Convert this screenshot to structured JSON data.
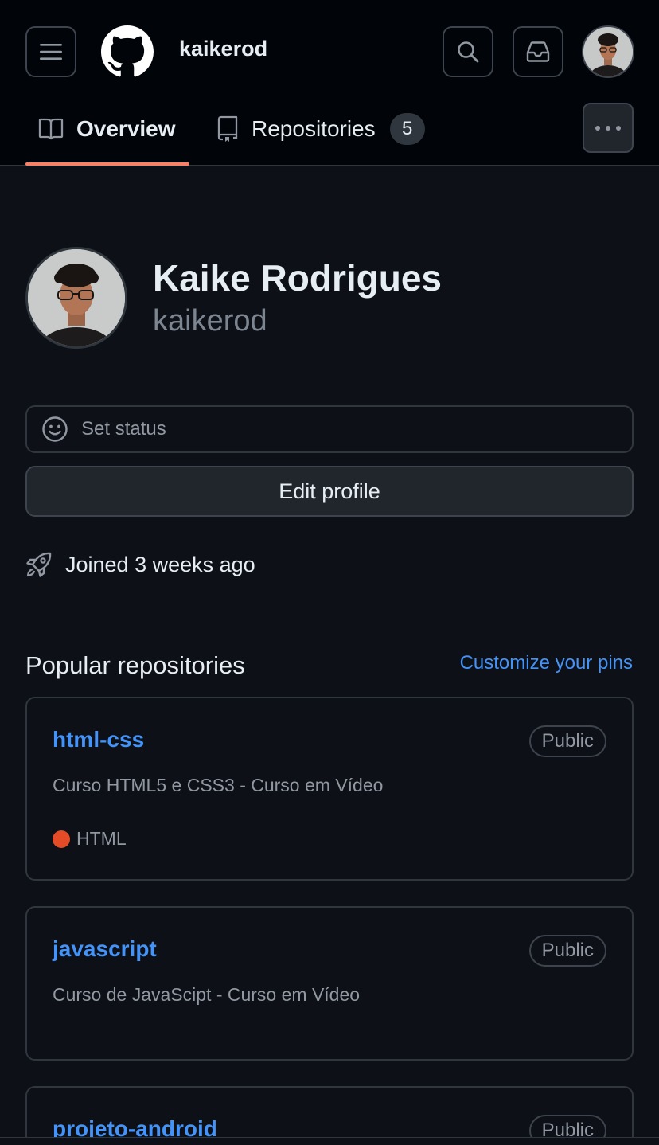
{
  "header": {
    "username": "kaikerod",
    "icons": {
      "menu": "hamburger-icon",
      "logo": "github-mark-icon",
      "search": "search-icon",
      "inbox": "inbox-icon",
      "more": "kebab-horizontal-icon"
    }
  },
  "tabs": [
    {
      "label": "Overview",
      "icon": "book-icon",
      "selected": true
    },
    {
      "label": "Repositories",
      "icon": "repo-icon",
      "count": "5",
      "selected": false
    }
  ],
  "profile": {
    "name": "Kaike Rodrigues",
    "login": "kaikerod",
    "set_status": "Set status",
    "edit_profile": "Edit profile",
    "joined": "Joined 3 weeks ago"
  },
  "popular": {
    "title": "Popular repositories",
    "customize": "Customize your pins",
    "repos": [
      {
        "name": "html-css",
        "visibility": "Public",
        "description": "Curso HTML5 e CSS3 - Curso em Vídeo",
        "language": "HTML",
        "language_color": "#e34c26"
      },
      {
        "name": "javascript",
        "visibility": "Public",
        "description": "Curso de JavaScipt - Curso em Vídeo"
      },
      {
        "name": "projeto-android",
        "visibility": "Public"
      }
    ]
  },
  "colors": {
    "background": "#0d1117",
    "header": "#010409",
    "accent_link": "#4493f8",
    "tab_underline": "#f78166"
  }
}
